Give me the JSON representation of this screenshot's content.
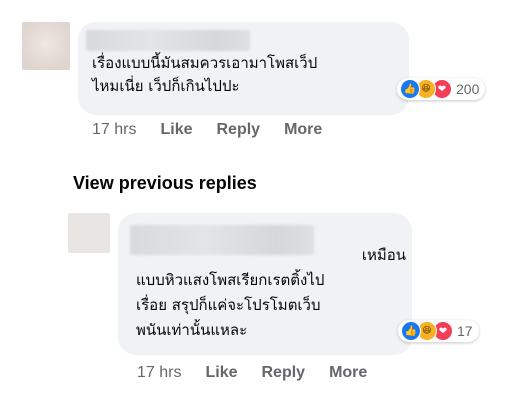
{
  "comment1": {
    "text": "เรื่องแบบนี้มันสมควรเอามาโพสเว็ป\nไหมเนี่ย เว็ปก็เกินไปปะ",
    "reactions": {
      "icons": [
        "like-icon",
        "haha-icon",
        "love-icon"
      ],
      "count": "200"
    },
    "time": "17 hrs",
    "like_label": "Like",
    "reply_label": "Reply",
    "more_label": "More"
  },
  "view_previous_replies": "View previous replies",
  "reply1": {
    "text_line1": "เหมือน",
    "text_rest": "แบบหิวแสงโพสเรียกเรตติ้งไป\nเรื่อย สรุปก็แค่จะโปรโมตเว็บ\nพนันเท่านั้นแหละ",
    "reactions": {
      "icons": [
        "like-icon",
        "haha-icon",
        "love-icon"
      ],
      "count": "17"
    },
    "time": "17 hrs",
    "like_label": "Like",
    "reply_label": "Reply",
    "more_label": "More"
  },
  "colors": {
    "bubble": "#f0f2f5",
    "meta_text": "#65676b",
    "like": "#1877f2",
    "haha": "#f7b125",
    "love": "#f33e58"
  }
}
